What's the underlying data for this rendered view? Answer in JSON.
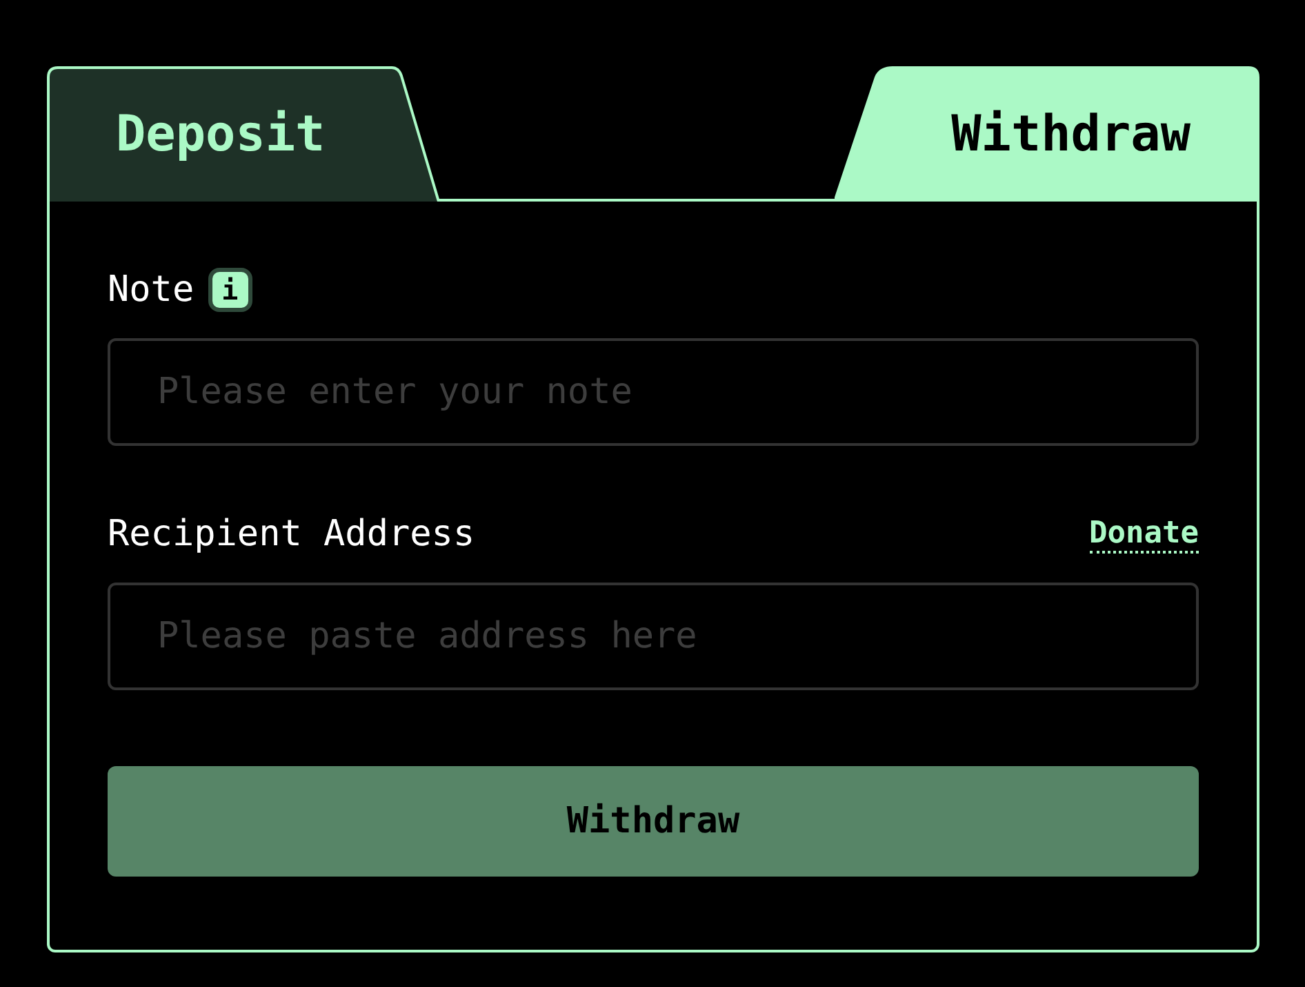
{
  "tabs": [
    {
      "label": "Deposit",
      "selected": false
    },
    {
      "label": "Withdraw",
      "selected": true
    }
  ],
  "note": {
    "label": "Note",
    "info": "i",
    "placeholder": "Please enter your note"
  },
  "recipient": {
    "label": "Recipient Address",
    "link": "Donate",
    "placeholder": "Please paste address here"
  },
  "submit": {
    "label": "Withdraw",
    "disabled": true
  }
}
